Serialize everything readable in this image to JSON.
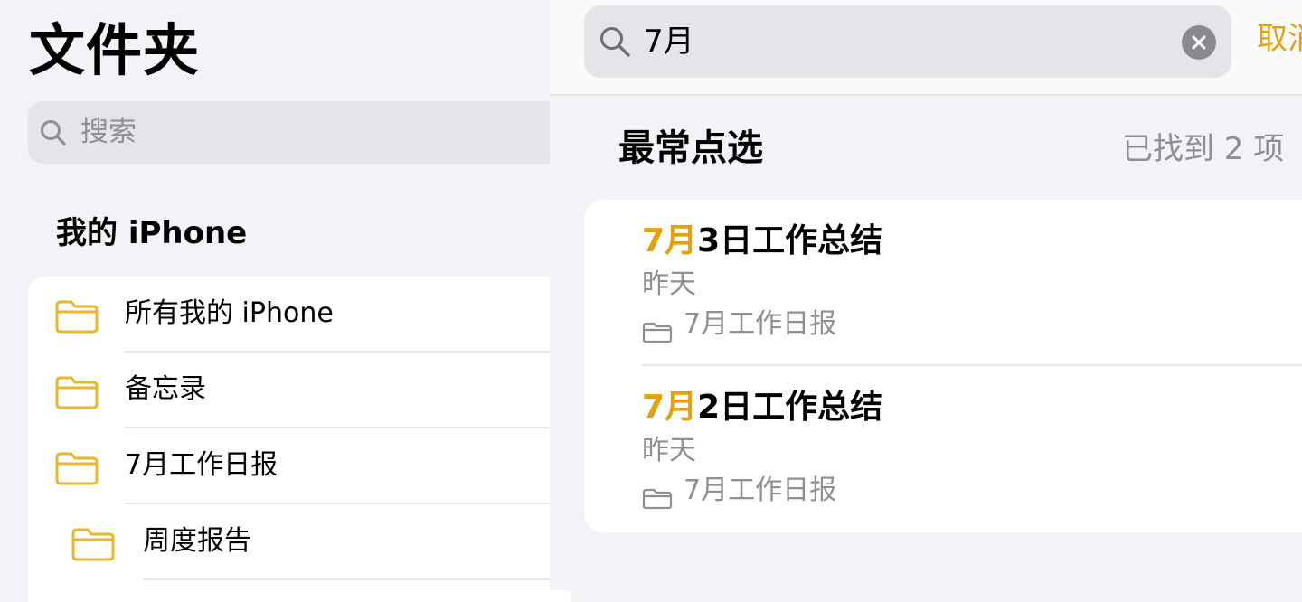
{
  "sidebar": {
    "title": "文件夹",
    "search_placeholder": "搜索",
    "section_title": "我的 iPhone",
    "folders": [
      {
        "label": "所有我的 iPhone"
      },
      {
        "label": "备忘录"
      },
      {
        "label": "7月工作日报"
      },
      {
        "label": "周度报告"
      }
    ]
  },
  "search": {
    "query": "7月",
    "cancel_label": "取消"
  },
  "results": {
    "section_title": "最常点选",
    "count_label": "已找到 2 项",
    "items": [
      {
        "title_highlight": "7月",
        "title_rest": "3日工作总结",
        "date": "昨天",
        "folder": "7月工作日报"
      },
      {
        "title_highlight": "7月",
        "title_rest": "2日工作总结",
        "date": "昨天",
        "folder": "7月工作日报"
      }
    ]
  },
  "colors": {
    "accent": "#e5a00d",
    "folder_icon": "#e9b728",
    "secondary_text": "#8e8e93",
    "background": "#f2f2f7"
  }
}
